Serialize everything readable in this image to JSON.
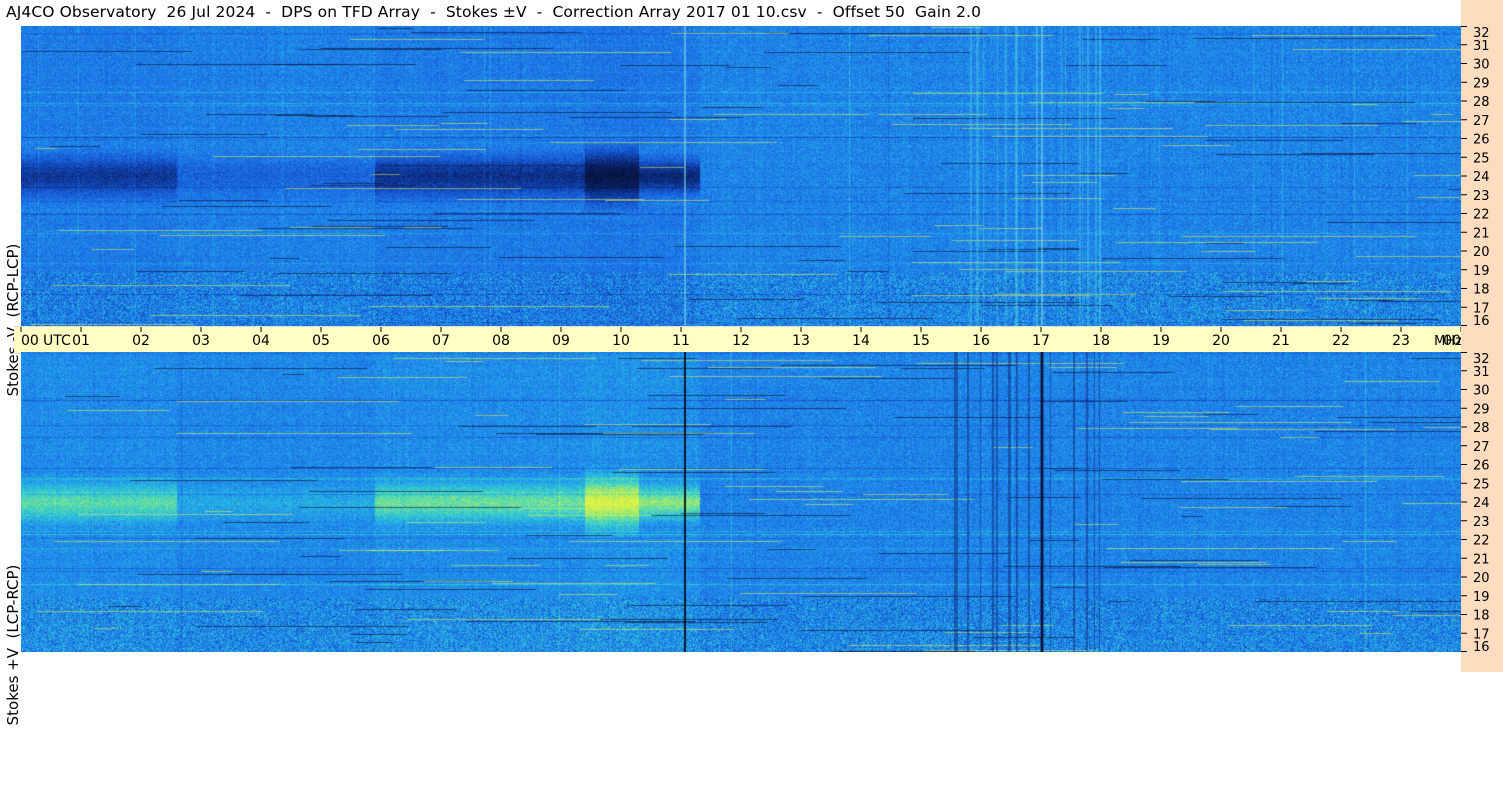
{
  "title": "AJ4CO Observatory  26 Jul 2024  -  DPS on TFD Array  -  Stokes ±V  -  Correction Array 2017 01 10.csv  -  Offset 50  Gain 2.0",
  "colors": {
    "background": "#ffffff",
    "time_strip": "#ffffc4",
    "freq_strip": "#fddcc0",
    "spectrogram_low": "#06153f",
    "spectrogram_mid": "#1f6fe6",
    "spectrogram_high": "#e8f540"
  },
  "chart_data": [
    {
      "type": "heatmap",
      "name": "top-panel",
      "ylabel": "Stokes -V  (RCP-LCP)",
      "xlabel": "",
      "x_ticks": [
        "00",
        "01",
        "02",
        "03",
        "04",
        "05",
        "06",
        "07",
        "08",
        "09",
        "10",
        "11",
        "12",
        "13",
        "14",
        "15",
        "16",
        "17",
        "18",
        "19",
        "20",
        "21",
        "22",
        "23",
        "00"
      ],
      "x_unit_label": "UTC",
      "y_ticks": [
        "16",
        "17",
        "18",
        "19",
        "20",
        "21",
        "22",
        "23",
        "24",
        "25",
        "26",
        "27",
        "28",
        "29",
        "30",
        "31",
        "32"
      ],
      "xlim": [
        0,
        24
      ],
      "ylim": [
        16,
        32
      ],
      "colormap": "dark-blue to blue to yellow",
      "features": [
        {
          "x": [
            0,
            2.6
          ],
          "y": [
            22.8,
            25.2
          ],
          "level": -0.55
        },
        {
          "x": [
            2.6,
            5.9
          ],
          "y": [
            22.8,
            25.2
          ],
          "level": -0.2
        },
        {
          "x": [
            5.9,
            9.4
          ],
          "y": [
            22.8,
            25.2
          ],
          "level": -0.6
        },
        {
          "x": [
            9.4,
            10.3
          ],
          "y": [
            22.5,
            25.5
          ],
          "level": -0.95
        },
        {
          "x": [
            10.3,
            11.3
          ],
          "y": [
            23.0,
            25.0
          ],
          "level": -0.7
        }
      ]
    },
    {
      "type": "heatmap",
      "name": "bottom-panel",
      "ylabel": "Stokes +V  (LCP-RCP)",
      "xlabel": "",
      "x_ticks": [
        "00",
        "01",
        "02",
        "03",
        "04",
        "05",
        "06",
        "07",
        "08",
        "09",
        "10",
        "11",
        "12",
        "13",
        "14",
        "15",
        "16",
        "17",
        "18",
        "19",
        "20",
        "21",
        "22",
        "23",
        "00"
      ],
      "x_unit_label": "UTC",
      "y_ticks": [
        "16",
        "17",
        "18",
        "19",
        "20",
        "21",
        "22",
        "23",
        "24",
        "25",
        "26",
        "27",
        "28",
        "29",
        "30",
        "31",
        "32"
      ],
      "xlim": [
        0,
        24
      ],
      "ylim": [
        16,
        32
      ],
      "colormap": "dark-blue to blue to yellow",
      "features": [
        {
          "x": [
            0,
            2.6
          ],
          "y": [
            22.8,
            25.2
          ],
          "level": 0.55
        },
        {
          "x": [
            2.6,
            5.9
          ],
          "y": [
            22.8,
            25.2
          ],
          "level": 0.2
        },
        {
          "x": [
            5.9,
            9.4
          ],
          "y": [
            22.8,
            25.2
          ],
          "level": 0.6
        },
        {
          "x": [
            9.4,
            10.3
          ],
          "y": [
            22.5,
            25.5
          ],
          "level": 0.95
        },
        {
          "x": [
            10.3,
            11.3
          ],
          "y": [
            23.0,
            25.0
          ],
          "level": 0.7
        }
      ]
    }
  ],
  "freq_unit": "MHz"
}
